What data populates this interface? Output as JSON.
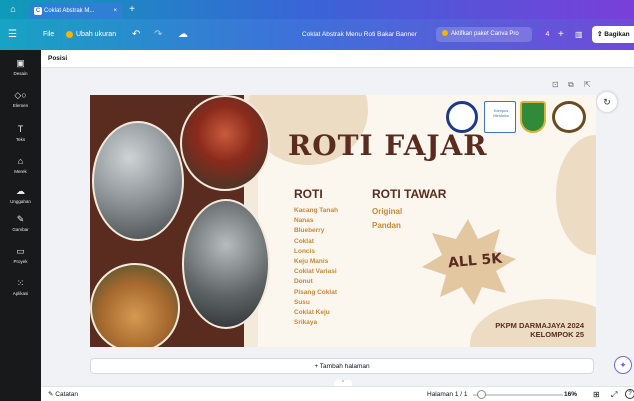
{
  "browser": {
    "tab_title": "Coklat Abstrak M...",
    "tab_close": "×",
    "new_tab": "+"
  },
  "menubar": {
    "file": "File",
    "resize": "Ubah ukuran",
    "doc_title": "Coklat Abstrak Menu Roti Bakar Banner",
    "pro_button": "Aktifkan paket Canva Pro",
    "avatar_initial": "4",
    "share": "Bagikan"
  },
  "sidebar": {
    "items": [
      {
        "label": "Desain",
        "icon": "layout-icon"
      },
      {
        "label": "Elemen",
        "icon": "shapes-icon"
      },
      {
        "label": "Teks",
        "icon": "text-icon"
      },
      {
        "label": "Merek",
        "icon": "brand-icon"
      },
      {
        "label": "Unggahan",
        "icon": "upload-icon"
      },
      {
        "label": "Gambar",
        "icon": "draw-icon"
      },
      {
        "label": "Proyek",
        "icon": "folder-icon"
      },
      {
        "label": "Aplikasi",
        "icon": "apps-icon"
      }
    ]
  },
  "toolbar2": {
    "position": "Posisi"
  },
  "design": {
    "title": "ROTI FAJAR",
    "roti_heading": "ROTI",
    "tawar_heading": "ROTI TAWAR",
    "roti_items": [
      "Kacang Tanah",
      "Nanas",
      "Blueberry",
      "Coklat",
      "Loncis",
      "Keju Manis",
      "Coklat Variasi",
      "Donut",
      "Pisang Coklat",
      "Susu",
      "Coklat Keju",
      "Srikaya"
    ],
    "tawar_items": [
      "Original",
      "Pandan"
    ],
    "price_badge": "ALL 5K",
    "footer_line1": "PKPM DARMAJAYA 2024",
    "footer_line2": "KELOMPOK 25",
    "logo_kampus_text": "Kampus Merdeka"
  },
  "add_page": "+ Tambah halaman",
  "footer": {
    "notes": "Catatan",
    "page_info": "Halaman 1 / 1",
    "zoom": "16%"
  },
  "zoom_level": 0.16,
  "colors": {
    "accent_gradient_start": "#17a3c3",
    "accent_gradient_end": "#6f4bd8",
    "brown": "#5a2c1f",
    "caramel": "#c58a3a",
    "cream": "#f4eadb"
  }
}
